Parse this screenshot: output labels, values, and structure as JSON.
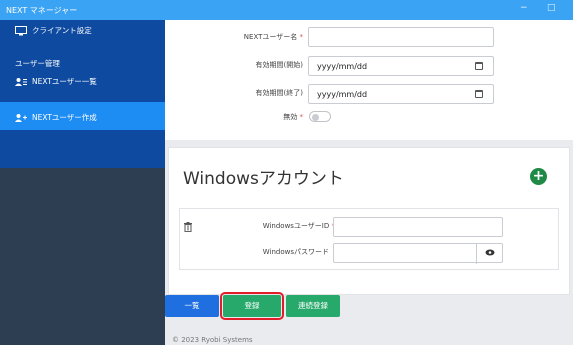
{
  "window": {
    "title": "NEXT マネージャー",
    "minimize": "−",
    "maximize": "□"
  },
  "sidebar": {
    "client_settings": "クライアント設定",
    "user_management": "ユーザー管理",
    "next_user_list": "NEXTユーザー一覧",
    "next_user_create": "NEXTユーザー作成"
  },
  "form": {
    "username_label": "NEXTユーザー名",
    "username_value": "",
    "start_label": "有効期間(開始)",
    "start_placeholder": "yyyy/mm/dd",
    "end_label": "有効期間(終了)",
    "end_placeholder": "yyyy/mm/dd",
    "disabled_label": "無効",
    "required_mark": "*"
  },
  "windows_account": {
    "title": "Windowsアカウント",
    "add": "+",
    "userid_label": "WindowsユーザーID",
    "userid_value": "",
    "password_label": "Windowsパスワード",
    "password_value": ""
  },
  "buttons": {
    "list": "一覧",
    "register": "登録",
    "continuous_register": "連続登録"
  },
  "footer": {
    "copyright": "© 2023 Ryobi Systems"
  },
  "colors": {
    "accent": "#1d8cf3",
    "sidebar_top": "#0e4aa0",
    "sidebar": "#2d3d52",
    "green": "#27a96b",
    "highlight": "#e11d2a"
  }
}
